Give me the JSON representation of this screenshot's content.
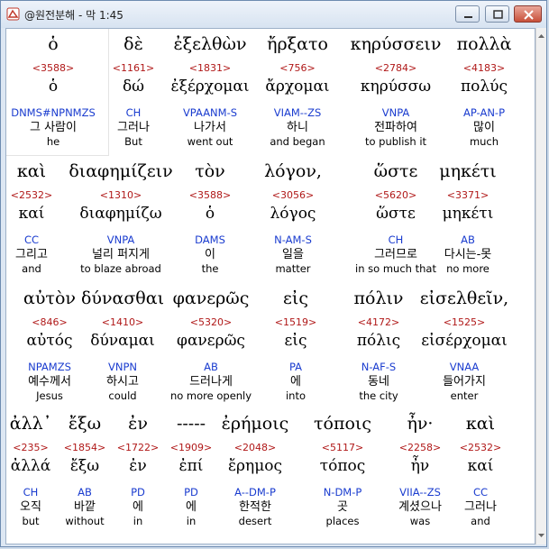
{
  "window": {
    "title": "@원전분해 - 막 1:45"
  },
  "rows": [
    [
      {
        "greek": "ὁ",
        "strong": "<3588>",
        "lemma": "ὁ",
        "parse": "DNMS#NPNMZS",
        "kor": "그 사람이",
        "eng": "he"
      },
      {
        "greek": "δὲ",
        "strong": "<1161>",
        "lemma": "δώ",
        "parse": "CH",
        "kor": "그러나",
        "eng": "But"
      },
      {
        "greek": "ἐξελθὼν",
        "strong": "<1831>",
        "lemma": "ἐξέρχομαι",
        "parse": "VPAANM-S",
        "kor": "나가서",
        "eng": "went out"
      },
      {
        "greek": "ἤρξατο",
        "strong": "<756>",
        "lemma": "ἄρχομαι",
        "parse": "VIAM--ZS",
        "kor": "하니",
        "eng": "and began"
      },
      {
        "greek": "κηρύσσειν",
        "strong": "<2784>",
        "lemma": "κηρύσσω",
        "parse": "VNPA",
        "kor": "전파하여",
        "eng": "to publish it"
      },
      {
        "greek": "πολλὰ",
        "strong": "<4183>",
        "lemma": "πολύς",
        "parse": "AP-AN-P",
        "kor": "많이",
        "eng": "much"
      }
    ],
    [
      {
        "greek": "καὶ",
        "strong": "<2532>",
        "lemma": "καί",
        "parse": "CC",
        "kor": "그리고",
        "eng": "and"
      },
      {
        "greek": "διαφημίζειν",
        "strong": "<1310>",
        "lemma": "διαφημίζω",
        "parse": "VNPA",
        "kor": "널리 퍼지게",
        "eng": "to blaze abroad"
      },
      {
        "greek": "τὸν",
        "strong": "<3588>",
        "lemma": "ὁ",
        "parse": "DAMS",
        "kor": "이",
        "eng": "the"
      },
      {
        "greek": "λόγον,",
        "strong": "<3056>",
        "lemma": "λόγος",
        "parse": "N-AM-S",
        "kor": "일을",
        "eng": "matter"
      },
      {
        "greek": "ὥστε",
        "strong": "<5620>",
        "lemma": "ὥστε",
        "parse": "CH",
        "kor": "그러므로",
        "eng": "in so much that"
      },
      {
        "greek": "μηκέτι",
        "strong": "<3371>",
        "lemma": "μηκέτι",
        "parse": "AB",
        "kor": "다시는-못",
        "eng": "no more"
      }
    ],
    [
      {
        "greek": "αὐτὸν",
        "strong": "<846>",
        "lemma": "αὐτός",
        "parse": "NPAMZS",
        "kor": "예수께서",
        "eng": "Jesus"
      },
      {
        "greek": "δύνασθαι",
        "strong": "<1410>",
        "lemma": "δύναμαι",
        "parse": "VNPN",
        "kor": "하시고",
        "eng": "could"
      },
      {
        "greek": "φανερῶς",
        "strong": "<5320>",
        "lemma": "φανερῶς",
        "parse": "AB",
        "kor": "드러나게",
        "eng": "no more openly"
      },
      {
        "greek": "εἰς",
        "strong": "<1519>",
        "lemma": "εἰς",
        "parse": "PA",
        "kor": "에",
        "eng": "into"
      },
      {
        "greek": "πόλιν",
        "strong": "<4172>",
        "lemma": "πόλις",
        "parse": "N-AF-S",
        "kor": "동네",
        "eng": "the city"
      },
      {
        "greek": "εἰσελθεῖν,",
        "strong": "<1525>",
        "lemma": "εἰσέρχομαι",
        "parse": "VNAA",
        "kor": "들어가지",
        "eng": "enter"
      }
    ],
    [
      {
        "greek": "ἀλλ᾽",
        "strong": "<235>",
        "lemma": "ἀλλά",
        "parse": "CH",
        "kor": "오직",
        "eng": "but"
      },
      {
        "greek": "ἔξω",
        "strong": "<1854>",
        "lemma": "ἔξω",
        "parse": "AB",
        "kor": "바깥",
        "eng": "without"
      },
      {
        "greek": "ἐν",
        "strong": "<1722>",
        "lemma": "ἐν",
        "parse": "PD",
        "kor": "에",
        "eng": "in"
      },
      {
        "greek": "-----",
        "strong": "<1909>",
        "lemma": "ἐπί",
        "parse": "PD",
        "kor": "에",
        "eng": "in"
      },
      {
        "greek": "ἐρήμοις",
        "strong": "<2048>",
        "lemma": "ἔρημος",
        "parse": "A--DM-P",
        "kor": "한적한",
        "eng": "desert"
      },
      {
        "greek": "τόποις",
        "strong": "<5117>",
        "lemma": "τόπος",
        "parse": "N-DM-P",
        "kor": "곳",
        "eng": "places"
      },
      {
        "greek": "ἦν·",
        "strong": "<2258>",
        "lemma": "ἦν",
        "parse": "VIIA--ZS",
        "kor": "계셨으나",
        "eng": "was"
      },
      {
        "greek": "καὶ",
        "strong": "<2532>",
        "lemma": "καί",
        "parse": "CC",
        "kor": "그러나",
        "eng": "and"
      }
    ]
  ]
}
